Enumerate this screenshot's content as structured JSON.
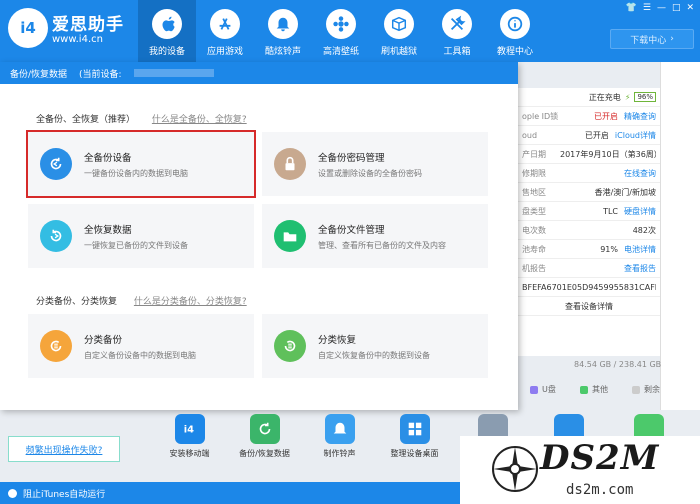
{
  "app": {
    "name": "爱思助手",
    "url": "www.i4.cn",
    "logo_text": "i4"
  },
  "nav": [
    {
      "label": "我的设备",
      "icon": "apple-icon",
      "active": true
    },
    {
      "label": "应用游戏",
      "icon": "app-store-icon"
    },
    {
      "label": "酷炫铃声",
      "icon": "bell-icon"
    },
    {
      "label": "高清壁纸",
      "icon": "flower-icon"
    },
    {
      "label": "刷机越狱",
      "icon": "box-icon"
    },
    {
      "label": "工具箱",
      "icon": "tools-icon"
    },
    {
      "label": "教程中心",
      "icon": "info-icon"
    }
  ],
  "window": {
    "download_center": "下载中心"
  },
  "dialog": {
    "title": "备份/恢复数据",
    "current_device_label": "(当前设备:",
    "section1": {
      "title": "全备份、全恢复（推荐）",
      "help": "什么是全备份、全恢复?"
    },
    "section2": {
      "title": "分类备份、分类恢复",
      "help": "什么是分类备份、分类恢复?"
    },
    "cards": [
      {
        "title": "全备份设备",
        "desc": "一键备份设备内的数据到电脑",
        "color": "#2a8fe6",
        "icon": "backup-icon"
      },
      {
        "title": "全备份密码管理",
        "desc": "设置或删除设备的全备份密码",
        "color": "#c8a98f",
        "icon": "lock-icon"
      },
      {
        "title": "全恢复数据",
        "desc": "一键恢复已备份的文件到设备",
        "color": "#33bde3",
        "icon": "restore-icon"
      },
      {
        "title": "全备份文件管理",
        "desc": "管理、查看所有已备份的文件及内容",
        "color": "#1fbf71",
        "icon": "folder-icon"
      },
      {
        "title": "分类备份",
        "desc": "自定义备份设备中的数据到电脑",
        "color": "#f5a53b",
        "icon": "category-backup-icon"
      },
      {
        "title": "分类恢复",
        "desc": "自定义恢复备份中的数据到设备",
        "color": "#5fc05b",
        "icon": "category-restore-icon"
      }
    ]
  },
  "info": {
    "charging": "正在充电",
    "battery": "96%",
    "rows": [
      {
        "k": "ople ID锁",
        "v": "已开启",
        "v_red": true,
        "link": "精确查询"
      },
      {
        "k": "oud",
        "v": "已开启",
        "link": "iCloud详情"
      },
      {
        "k": "产日期",
        "v": "2017年9月10日（第36周）",
        "link": ""
      },
      {
        "k": "修期限",
        "v": "",
        "link": "在线查询"
      },
      {
        "k": "售地区",
        "v": "香港/澳门/新加坡",
        "link": ""
      },
      {
        "k": "盘类型",
        "v": "TLC",
        "link": "硬盘详情"
      },
      {
        "k": "电次数",
        "v": "482次",
        "link": ""
      },
      {
        "k": "池寿命",
        "v": "91%",
        "link": "电池详情"
      },
      {
        "k": "机报告",
        "v": "",
        "link": "查看报告"
      },
      {
        "k": "",
        "v": "BFEFA6701E05D9459955831CAFF",
        "link": ""
      },
      {
        "k": "",
        "v": "查看设备详情",
        "link": ""
      }
    ],
    "storage": "84.54 GB / 238.41 GB",
    "legend": [
      {
        "label": "U盘",
        "color": "#8e7cf0"
      },
      {
        "label": "其他",
        "color": "#4cc96b"
      },
      {
        "label": "剩余",
        "color": "#cccccc"
      }
    ]
  },
  "tools": [
    {
      "label": "安装移动端",
      "color": "#1c87e8",
      "icon": "i4-icon"
    },
    {
      "label": "备份/恢复数据",
      "color": "#3bb56a",
      "icon": "backup-restore-icon"
    },
    {
      "label": "制作铃声",
      "color": "#3aa0ef",
      "icon": "ringtone-icon"
    },
    {
      "label": "整理设备桌面",
      "color": "#2a8fe6",
      "icon": "grid-icon"
    }
  ],
  "problem_link": "频繁出现操作失败?",
  "statusbar": {
    "text": "阻止iTunes自动运行"
  },
  "watermark": {
    "main": "DS2M",
    "sub": "ds2m.com"
  }
}
